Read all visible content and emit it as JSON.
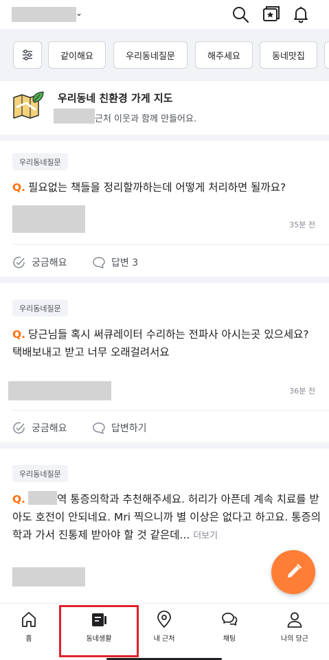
{
  "header": {
    "location_chevron": "⌄",
    "icons": [
      "search-icon",
      "news-icon",
      "bell-icon"
    ]
  },
  "categories": {
    "filter_icon": "sliders-icon",
    "chips": [
      "같이해요",
      "우리동네질문",
      "해주세요",
      "동네맛집"
    ]
  },
  "banner": {
    "title": "우리동네 친환경 가게 지도",
    "subtitle": "근처 이웃과 함께 만들어요."
  },
  "posts": [
    {
      "badge": "우리동네질문",
      "q_prefix": "Q.",
      "text": "필요없는 책들을 정리할까하는데 어떻게 처리하면 될까요?",
      "time": "35분 전",
      "like_label": "궁금해요",
      "comment_label": "답변 3"
    },
    {
      "badge": "우리동네질문",
      "q_prefix": "Q.",
      "text": "당근님들 혹시 써큐레이터 수리하는 전파사 아시는곳 있으세요? 택배보내고 받고 너무 오래걸려서요",
      "time": "36분 전",
      "like_label": "궁금해요",
      "comment_label": "답변하기"
    },
    {
      "badge": "우리동네질문",
      "q_prefix": "Q.",
      "text": "역 통증의학과 추천해주세요. 허리가 아픈데 계속 치료를 받아도 호전이 안되네요. Mri 찍으니까 별 이상은 없다고 하고요. 통증의학과 가서 진통제 받아야 할 것 같은데...",
      "more": "더보기"
    }
  ],
  "bottom_nav": [
    {
      "label": "홈",
      "icon": "home-icon"
    },
    {
      "label": "동네생활",
      "icon": "community-icon"
    },
    {
      "label": "내 근처",
      "icon": "location-pin-icon"
    },
    {
      "label": "채팅",
      "icon": "chat-icon"
    },
    {
      "label": "나의 당근",
      "icon": "user-icon"
    }
  ],
  "colors": {
    "accent": "#ff6f0f",
    "fab": "#ff7e36",
    "highlight": "#e0202a"
  }
}
